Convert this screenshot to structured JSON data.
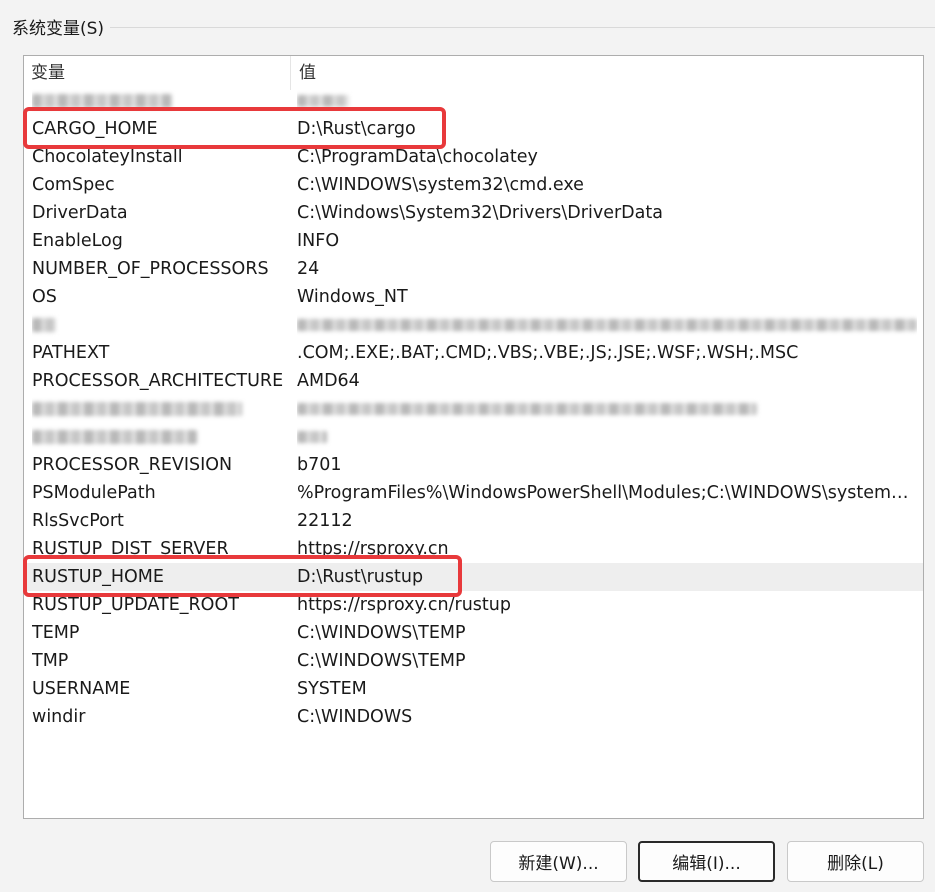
{
  "group": {
    "title": "系统变量(S)"
  },
  "list": {
    "columns": {
      "variable": "变量",
      "value": "值"
    },
    "rows": [
      {
        "name": "",
        "value": "",
        "redacted": true
      },
      {
        "name": "CARGO_HOME",
        "value": "D:\\Rust\\cargo"
      },
      {
        "name": "ChocolateyInstall",
        "value": "C:\\ProgramData\\chocolatey"
      },
      {
        "name": "ComSpec",
        "value": "C:\\WINDOWS\\system32\\cmd.exe"
      },
      {
        "name": "DriverData",
        "value": "C:\\Windows\\System32\\Drivers\\DriverData"
      },
      {
        "name": "EnableLog",
        "value": "INFO"
      },
      {
        "name": "NUMBER_OF_PROCESSORS",
        "value": "24"
      },
      {
        "name": "OS",
        "value": "Windows_NT"
      },
      {
        "name": "",
        "value": "",
        "redacted": true
      },
      {
        "name": "PATHEXT",
        "value": ".COM;.EXE;.BAT;.CMD;.VBS;.VBE;.JS;.JSE;.WSF;.WSH;.MSC"
      },
      {
        "name": "PROCESSOR_ARCHITECTURE",
        "value": "AMD64"
      },
      {
        "name": "",
        "value": "",
        "redacted": true
      },
      {
        "name": "",
        "value": "",
        "redacted": true
      },
      {
        "name": "PROCESSOR_REVISION",
        "value": "b701"
      },
      {
        "name": "PSModulePath",
        "value": "%ProgramFiles%\\WindowsPowerShell\\Modules;C:\\WINDOWS\\system3..."
      },
      {
        "name": "RlsSvcPort",
        "value": "22112"
      },
      {
        "name": "RUSTUP_DIST_SERVER",
        "value": "https://rsproxy.cn"
      },
      {
        "name": "RUSTUP_HOME",
        "value": "D:\\Rust\\rustup",
        "selected": true
      },
      {
        "name": "RUSTUP_UPDATE_ROOT",
        "value": "https://rsproxy.cn/rustup"
      },
      {
        "name": "TEMP",
        "value": "C:\\WINDOWS\\TEMP"
      },
      {
        "name": "TMP",
        "value": "C:\\WINDOWS\\TEMP"
      },
      {
        "name": "USERNAME",
        "value": "SYSTEM"
      },
      {
        "name": "windir",
        "value": "C:\\WINDOWS"
      }
    ]
  },
  "buttons": {
    "new": "新建(W)...",
    "edit": "编辑(I)...",
    "delete": "删除(L)"
  },
  "colors": {
    "highlight": "#e8393b",
    "selection": "#eeeeee",
    "background": "#f3f3f3"
  }
}
